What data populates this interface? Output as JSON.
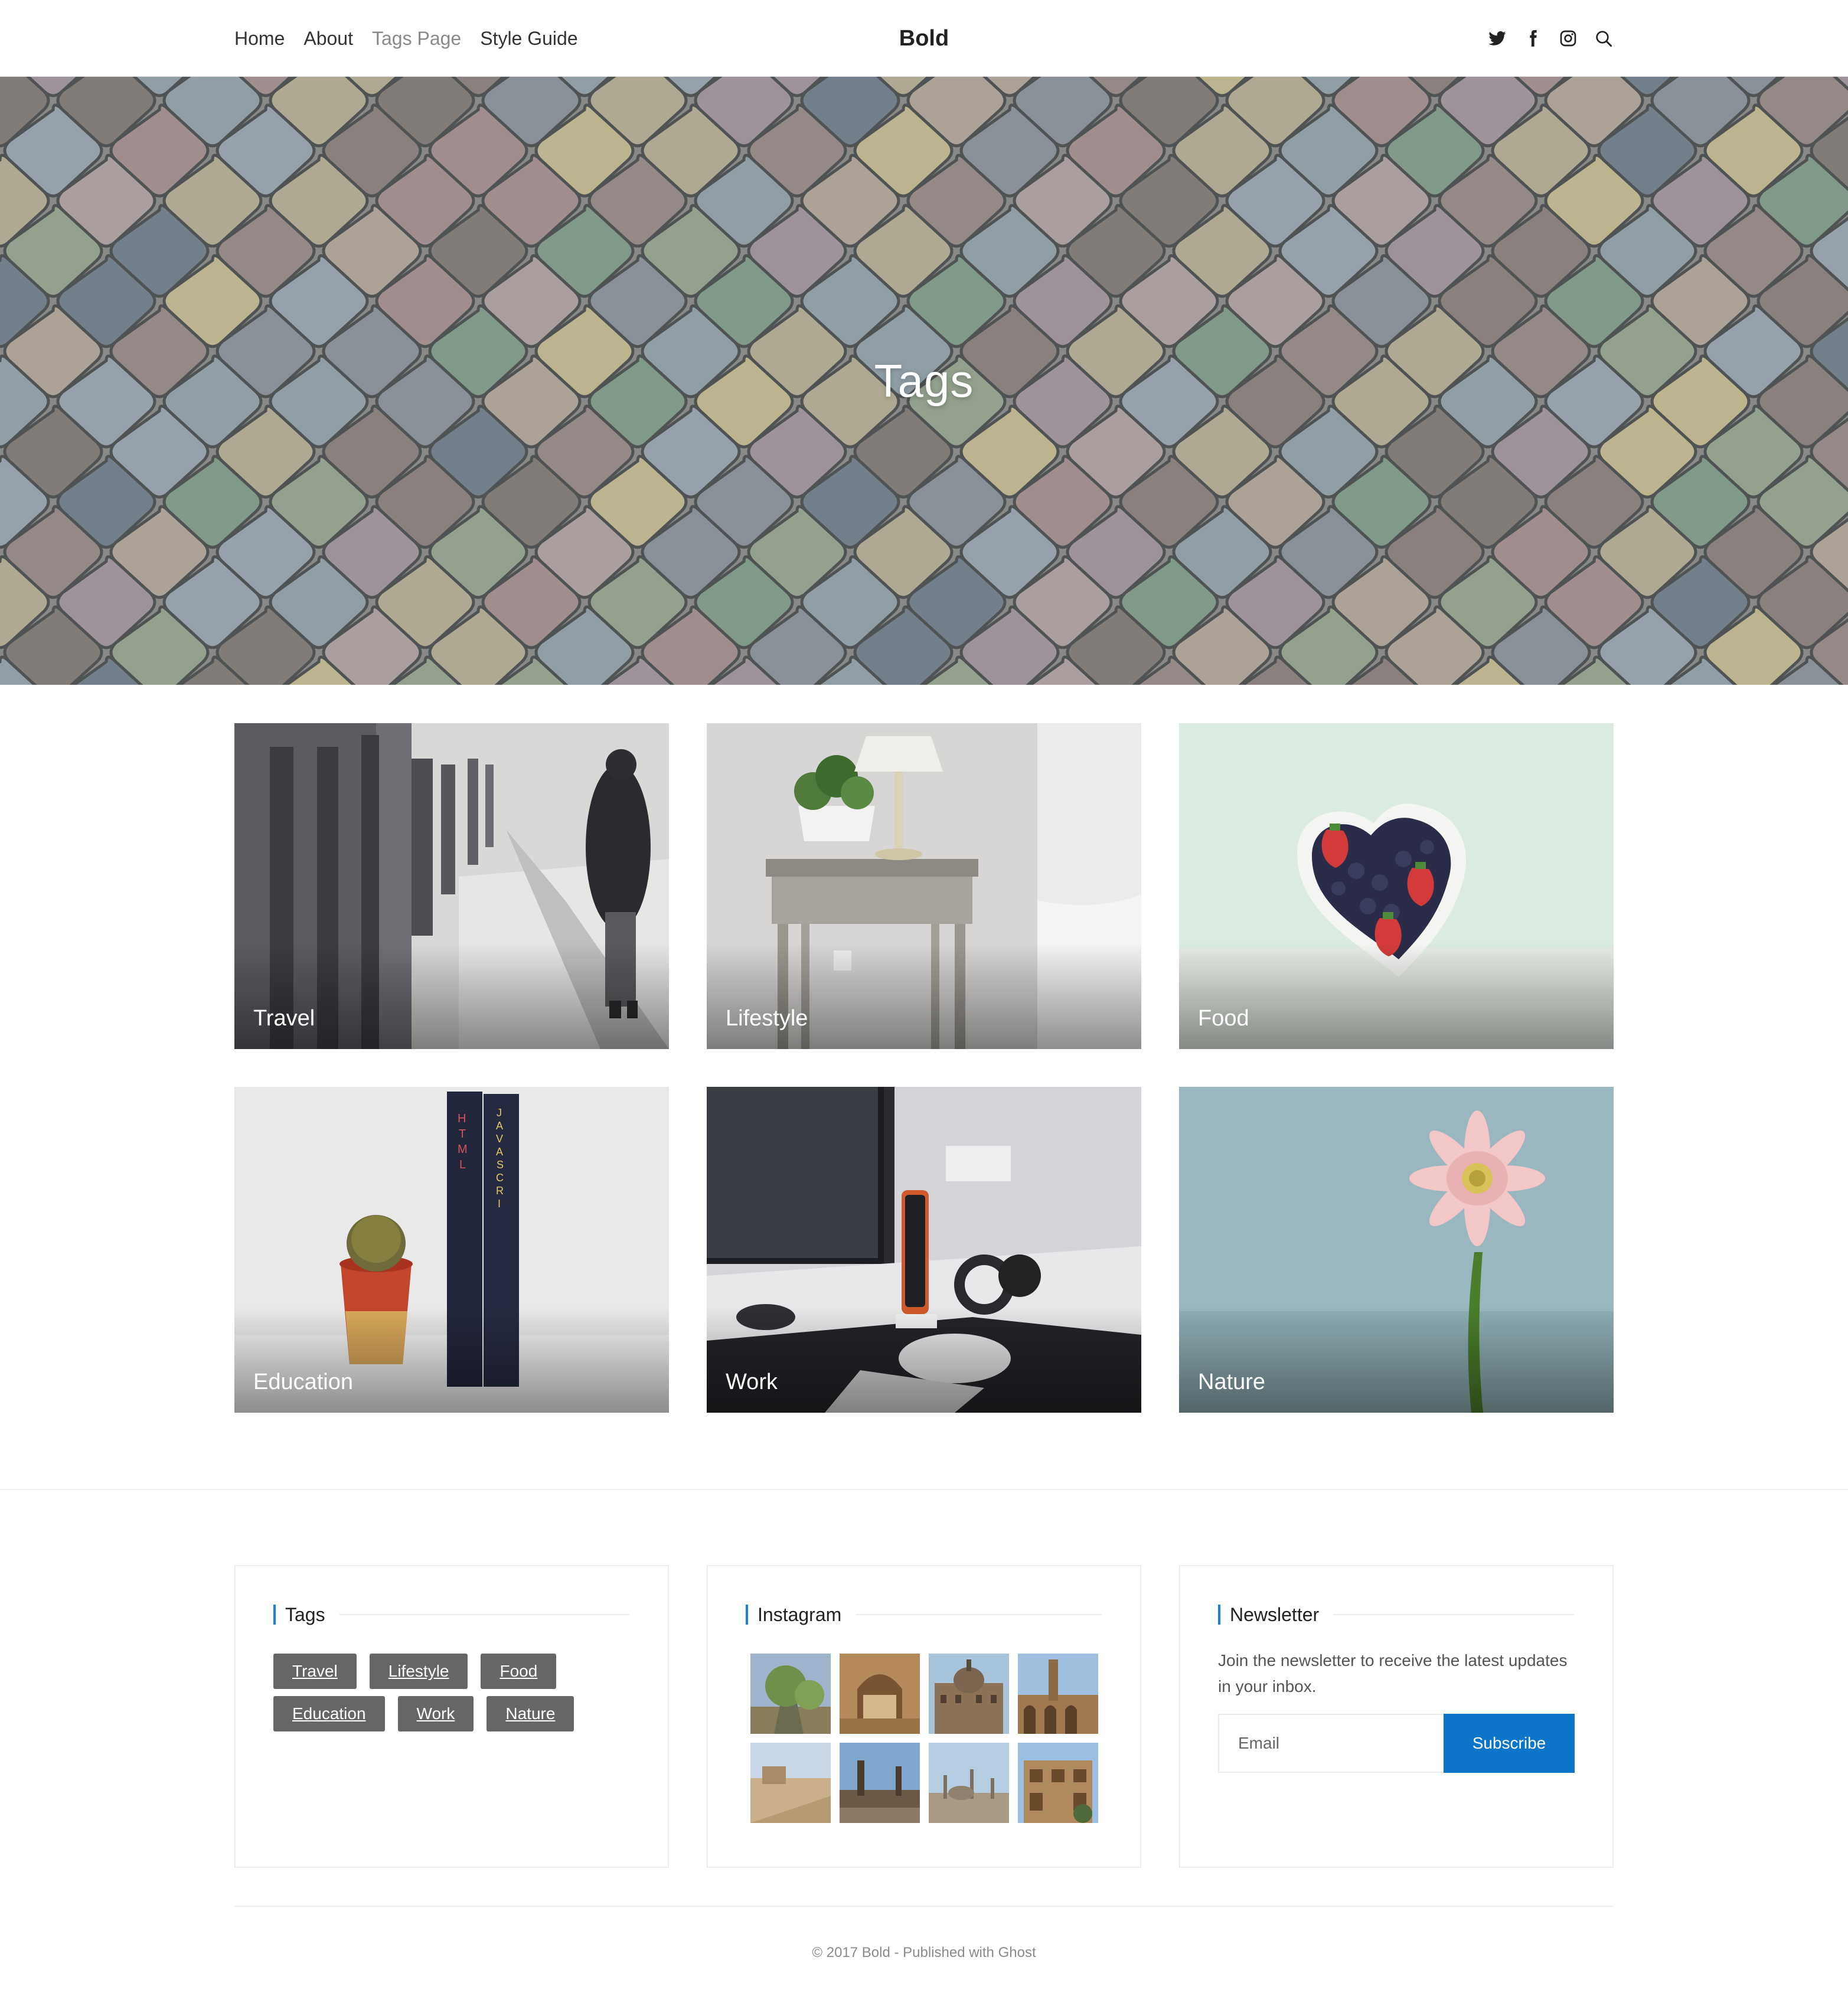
{
  "header": {
    "nav": [
      {
        "label": "Home",
        "current": false
      },
      {
        "label": "About",
        "current": false
      },
      {
        "label": "Tags Page",
        "current": true
      },
      {
        "label": "Style Guide",
        "current": false
      }
    ],
    "site_title": "Bold",
    "icons": [
      "twitter-icon",
      "facebook-icon",
      "instagram-icon",
      "search-icon"
    ]
  },
  "hero": {
    "title": "Tags"
  },
  "tag_cards": [
    {
      "label": "Travel"
    },
    {
      "label": "Lifestyle"
    },
    {
      "label": "Food"
    },
    {
      "label": "Education"
    },
    {
      "label": "Work"
    },
    {
      "label": "Nature"
    }
  ],
  "footer": {
    "tags_widget": {
      "title": "Tags",
      "tags": [
        "Travel",
        "Lifestyle",
        "Food",
        "Education",
        "Work",
        "Nature"
      ]
    },
    "instagram_widget": {
      "title": "Instagram"
    },
    "newsletter_widget": {
      "title": "Newsletter",
      "text": "Join the newsletter to receive the latest updates in your inbox.",
      "email_placeholder": "Email",
      "button_label": "Subscribe"
    },
    "copyright": "© 2017 Bold - Published with Ghost"
  },
  "colors": {
    "accent": "#0a75c9",
    "tag_bg": "#666666",
    "title_bar": "#1a7fd4"
  }
}
